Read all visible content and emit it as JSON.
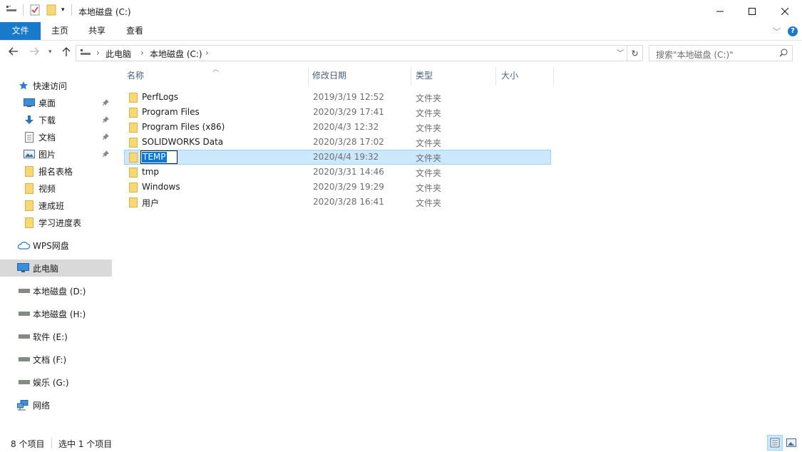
{
  "window": {
    "title": "本地磁盘 (C:)"
  },
  "ribbon": {
    "tabs": [
      "文件",
      "主页",
      "共享",
      "查看"
    ]
  },
  "address": {
    "crumbs": [
      "此电脑",
      "本地磁盘 (C:)"
    ],
    "search_placeholder": "搜索\"本地磁盘 (C:)\""
  },
  "nav": {
    "quick_access": "快速访问",
    "pinned": [
      "桌面",
      "下载",
      "文档",
      "图片"
    ],
    "folders": [
      "报名表格",
      "视频",
      "速成班",
      "学习进度表"
    ],
    "wps": "WPS网盘",
    "this_pc": "此电脑",
    "drives": [
      "本地磁盘 (D:)",
      "本地磁盘 (H:)",
      "软件 (E:)",
      "文档 (F:)",
      "娱乐 (G:)"
    ],
    "network": "网络"
  },
  "columns": {
    "name": "名称",
    "date": "修改日期",
    "type": "类型",
    "size": "大小"
  },
  "files": [
    {
      "name": "PerfLogs",
      "date": "2019/3/19 12:52",
      "type": "文件夹"
    },
    {
      "name": "Program Files",
      "date": "2020/3/29 17:41",
      "type": "文件夹"
    },
    {
      "name": "Program Files (x86)",
      "date": "2020/4/3 12:32",
      "type": "文件夹"
    },
    {
      "name": "SOLIDWORKS Data",
      "date": "2020/3/28 17:02",
      "type": "文件夹"
    },
    {
      "name": "TEMP",
      "date": "2020/4/4 19:32",
      "type": "文件夹",
      "selected": true,
      "renaming": true
    },
    {
      "name": "tmp",
      "date": "2020/3/31 14:46",
      "type": "文件夹"
    },
    {
      "name": "Windows",
      "date": "2020/3/29 19:29",
      "type": "文件夹"
    },
    {
      "name": "用户",
      "date": "2020/3/28 16:41",
      "type": "文件夹"
    }
  ],
  "status": {
    "item_count": "8 个项目",
    "selected": "选中 1 个项目"
  },
  "colors": {
    "accent": "#1979ca",
    "selection": "#cce8ff",
    "folder": "#f8d775"
  }
}
